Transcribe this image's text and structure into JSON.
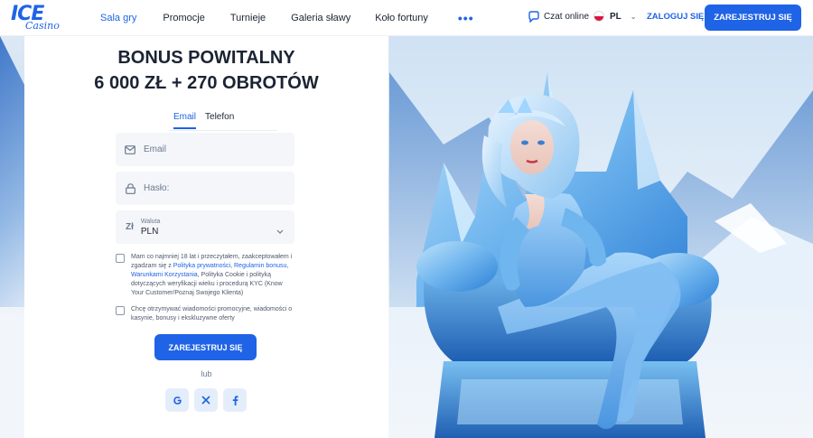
{
  "header": {
    "logo_top": "ICE",
    "logo_bottom": "Casino",
    "nav": [
      "Sala gry",
      "Promocje",
      "Turnieje",
      "Galeria sławy",
      "Koło fortuny"
    ],
    "more": "•••",
    "chat": "Czat online",
    "lang": "PL",
    "login": "ZALOGUJ SIĘ",
    "register": "ZAREJESTRUJ SIĘ"
  },
  "form": {
    "title_line1": "BONUS POWITALNY",
    "title_line2": "6 000 ZŁ + 270 OBROTÓW",
    "tabs": [
      "Email",
      "Telefon"
    ],
    "email_placeholder": "Email",
    "password_placeholder": "Hasło:",
    "currency_symbol": "Zł",
    "currency_label": "Waluta",
    "currency_value": "PLN",
    "terms": {
      "pre": "Mam co najmniej 18 lat i przeczytałem, zaakceptowałem i zgadzam się z ",
      "link1": "Polityka prywatności",
      "sep1": ", ",
      "link2": "Regulamin bonusu",
      "sep2": ", ",
      "link3": "Warunkami Korzystania",
      "post": ", Polityka Cookie i polityką dotyczących weryfikacji wieku i procedurą KYC (Know Your Customer/Poznaj Swojego Klienta)"
    },
    "promo": "Chcę otrzymywać wiadomości promocyjne, wiadomości o kasynie, bonusy i ekskluzywne oferty",
    "submit": "ZAREJESTRUJ SIĘ",
    "or": "lub",
    "socials": [
      "google-icon",
      "x-icon",
      "facebook-icon"
    ]
  },
  "colors": {
    "accent": "#1f63e6",
    "text": "#1b2433"
  }
}
